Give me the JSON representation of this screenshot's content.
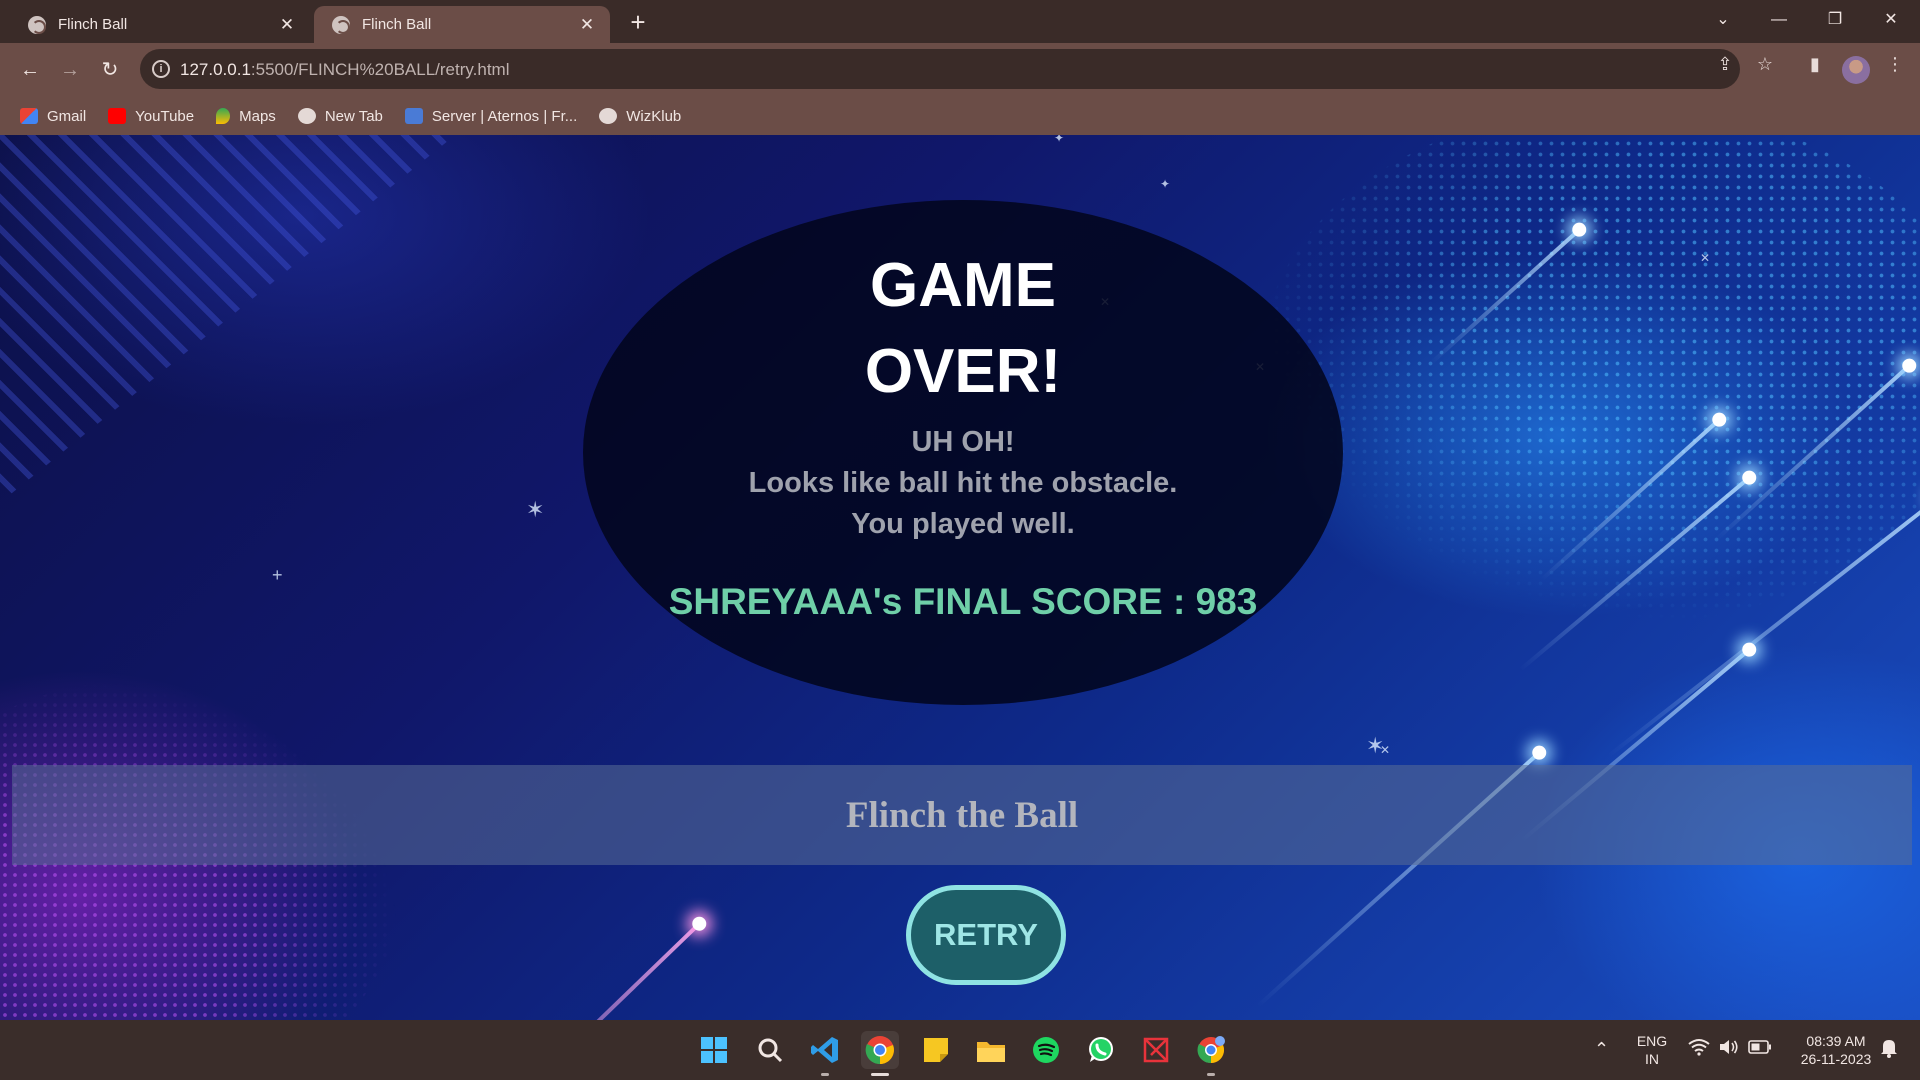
{
  "browser": {
    "tabs": [
      {
        "title": "Flinch Ball",
        "active": false
      },
      {
        "title": "Flinch Ball",
        "active": true
      }
    ],
    "url_host": "127.0.0.1",
    "url_rest": ":5500/FLINCH%20BALL/retry.html",
    "bookmarks": [
      {
        "label": "Gmail",
        "icon": "gmail-icon",
        "color": "#ea4335"
      },
      {
        "label": "YouTube",
        "icon": "youtube-icon",
        "color": "#ff0000"
      },
      {
        "label": "Maps",
        "icon": "maps-icon",
        "color": "#34a853"
      },
      {
        "label": "New Tab",
        "icon": "globe-icon",
        "color": "#cfc3c0"
      },
      {
        "label": "Server | Aternos | Fr...",
        "icon": "aternos-icon",
        "color": "#4a7bd6"
      },
      {
        "label": "WizKlub",
        "icon": "globe-icon",
        "color": "#cfc3c0"
      }
    ]
  },
  "game": {
    "title_line1": "GAME",
    "title_line2": "OVER!",
    "msg_line1": "UH OH!",
    "msg_line2": "Looks like ball hit the obstacle.",
    "msg_line3": "You played well.",
    "score_text": "SHREYAAA's FINAL SCORE : 983",
    "banner": "Flinch the Ball",
    "retry_label": "RETRY"
  },
  "taskbar": {
    "apps": [
      {
        "name": "windows-start-icon",
        "active": false
      },
      {
        "name": "search-icon",
        "active": false
      },
      {
        "name": "vscode-icon",
        "active": false
      },
      {
        "name": "chrome-icon",
        "active": true
      },
      {
        "name": "sticky-notes-icon",
        "active": false
      },
      {
        "name": "file-explorer-icon",
        "active": false
      },
      {
        "name": "spotify-icon",
        "active": false
      },
      {
        "name": "whatsapp-icon",
        "active": false
      },
      {
        "name": "app-icon",
        "active": false
      },
      {
        "name": "chrome-canary-icon",
        "active": false
      }
    ],
    "lang_line1": "ENG",
    "lang_line2": "IN",
    "time": "08:39 AM",
    "date": "26-11-2023"
  },
  "colors": {
    "score": "#6fcfa8",
    "retry_border": "#8fe3e3",
    "retry_fill": "#1d5f68"
  }
}
